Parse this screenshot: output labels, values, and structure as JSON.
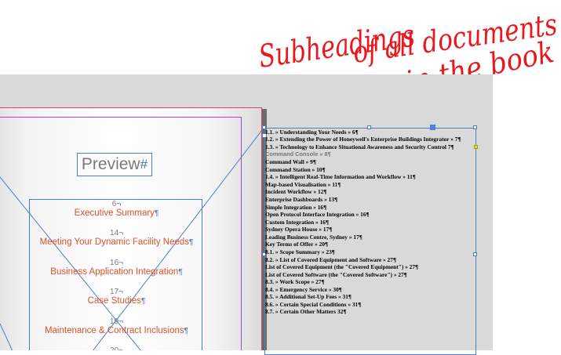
{
  "annotation": {
    "line1": "Subheadings",
    "line2": "of all documents",
    "line3": "in the book"
  },
  "left_page": {
    "preview_title": "Preview",
    "preview_mark": "#",
    "toc": [
      {
        "page": "6",
        "title": "Executive Summary"
      },
      {
        "page": "14",
        "title": "Meeting Your Dynamic Facility Needs"
      },
      {
        "page": "16",
        "title": "Business Application Integration"
      },
      {
        "page": "17",
        "title": "Case Studies"
      },
      {
        "page": "19",
        "title": "Maintenance & Contract Inclusions"
      },
      {
        "page": "20",
        "title": ""
      }
    ]
  },
  "subheadings": [
    {
      "text": "1.1. » Understanding Your Needs » 6¶"
    },
    {
      "text": "1.2. » Extending the Power of Honeywell's Enterprise Buildings Integrator » 7¶"
    },
    {
      "text": "1.3. » Technology to Enhance Situational Awareness and Security Control 7¶"
    },
    {
      "text": "Command Console » 8¶",
      "style": "grey"
    },
    {
      "text": "Command Wall » 9¶"
    },
    {
      "text": "Command Station » 10¶"
    },
    {
      "text": "1.4. » Intelligent Real-Time Information and Workflow » 11¶"
    },
    {
      "text": "Map-based Visualisation » 11¶"
    },
    {
      "text": "Incident Workflow » 12¶"
    },
    {
      "text": "Enterprise Dashboards » 13¶"
    },
    {
      "text": "Simple Integration » 16¶"
    },
    {
      "text": "Open Protocol Interface Integration » 16¶"
    },
    {
      "text": "Custom Integration » 16¶"
    },
    {
      "text": "Sydney Opera House » 17¶"
    },
    {
      "text": "Leading Business Centre, Sydney » 17¶"
    },
    {
      "text": "Key Terms of Offer » 20¶"
    },
    {
      "text": "8.1. » Scope Summary » 23¶"
    },
    {
      "text": "8.2. » List of Covered Equipment and Software » 27¶"
    },
    {
      "text": "List of Covered Equipment (the \"Covered Equipment\") » 27¶"
    },
    {
      "text": "List of Covered Software (the \"Covered Software\") » 27¶"
    },
    {
      "text": "8.3. » Work Scope » 27¶"
    },
    {
      "text": "8.4. » Emergency Service » 30¶"
    },
    {
      "text": "8.5. » Additional Set-Up Fees » 31¶"
    },
    {
      "text": "8.6. » Certain Special Conditions » 31¶"
    },
    {
      "text": "8.7. » Certain Other Matters 32¶"
    }
  ],
  "colors": {
    "annotation": "#e8191e",
    "toc_title": "#d9522a",
    "frame": "#4b7ec8",
    "margin_guide": "#b43be0"
  }
}
